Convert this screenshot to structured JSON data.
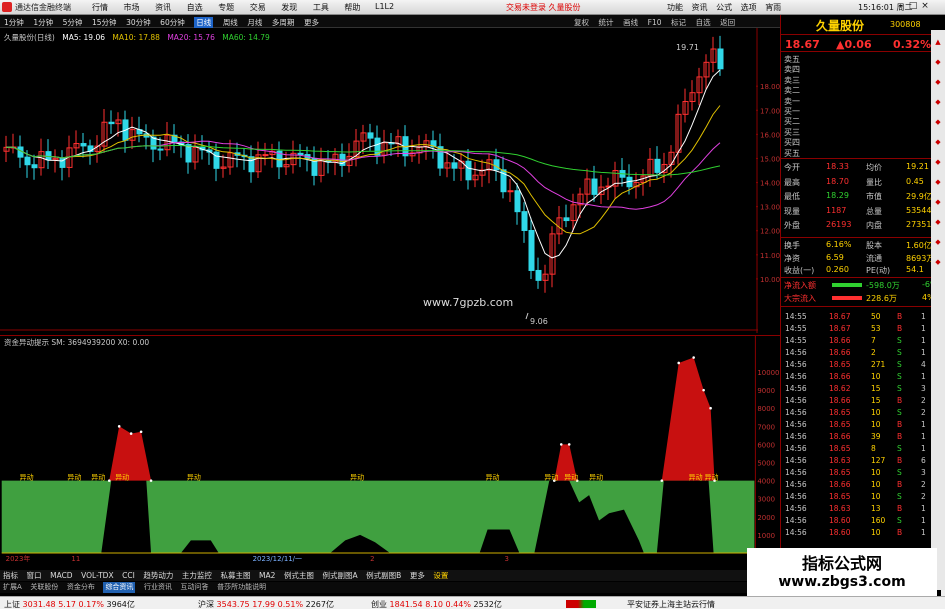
{
  "menubar": {
    "app_title": "通达信金融终端",
    "menu": [
      "行情",
      "市场",
      "资讯",
      "自选",
      "专题",
      "交易",
      "发现",
      "工具",
      "帮助"
    ],
    "version": "L1L2",
    "notice": "交易未登录   久量股份",
    "right": [
      "功能",
      "资讯",
      "公式",
      "选项",
      "宵雨"
    ],
    "clock": "15:16:01",
    "weekday": "周二"
  },
  "toolbar": {
    "periods": [
      "1分钟",
      "1分钟",
      "5分钟",
      "15分钟",
      "30分钟",
      "60分钟",
      "日线",
      "周线",
      "月线",
      "多周期",
      "更多"
    ],
    "active_period": "日线",
    "tools": [
      "复权",
      "统计",
      "画线",
      "F10",
      "标记",
      "自选",
      "返回"
    ]
  },
  "main_legend": {
    "stock": "久量股份(日线)",
    "ma5": "MA5: 19.06",
    "ma10": "MA10: 17.88",
    "ma20": "MA20: 15.76",
    "ma60": "MA60: 14.79"
  },
  "price_axis": [
    "18.00",
    "17.00",
    "16.00",
    "15.00",
    "14.00",
    "13.00",
    "12.00",
    "11.00",
    "10.00"
  ],
  "chart_annotations": {
    "high": "19.71",
    "low": "9.06",
    "website": "www.7gpzb.com"
  },
  "indicator": {
    "legend": "资金异动提示  SM: 3694939200   X0: 0.00",
    "axis": [
      "10000",
      "9000",
      "8000",
      "7000",
      "6000",
      "5000",
      "4000",
      "3000",
      "2000",
      "1000"
    ],
    "marker": "异动",
    "date_labels": [
      "2023年",
      "11",
      "2023/12/11/一",
      "2",
      "3"
    ]
  },
  "tabs": [
    "指标",
    "窗口",
    "MACD",
    "VOL-TDX",
    "CCI",
    "趋势动力",
    "主力监控",
    "私募主图",
    "MA2",
    "例式主图",
    "例式副图A",
    "例式副图B",
    "更多",
    "设置"
  ],
  "tabs_right": "横排",
  "tabs2": [
    "扩展A",
    "关联股份",
    "资金分布",
    "综合资讯",
    "行业资讯",
    "互动问答",
    "普莎所功能说明"
  ],
  "tabs2_active": "综合资讯",
  "status": {
    "sh_label": "上证",
    "sh_value": "3031.48",
    "sh_change": "5.17",
    "sh_pct": "0.17%",
    "sh_amount": "3964亿",
    "sz_label": "沪深",
    "sz_value": "3543.75",
    "sz_change": "17.99",
    "sz_pct": "0.51%",
    "sz_amount": "2267亿",
    "cy_label": "创业",
    "cy_value": "1841.54",
    "cy_change": "8.10",
    "cy_pct": "0.44%",
    "cy_amount": "2532亿",
    "broker": "平安证券上海主站云行情"
  },
  "rpanel": {
    "name": "久量股份",
    "code": "300808",
    "price": "18.67",
    "change": "▲0.06",
    "pct": "0.32%",
    "orderbook": [
      "卖五",
      "卖四",
      "卖三",
      "卖二",
      "卖一",
      "买一",
      "买二",
      "买三",
      "买四",
      "买五"
    ],
    "stats": [
      [
        "今开",
        "18.33",
        "均价",
        "19.21"
      ],
      [
        "最高",
        "18.70",
        "量比",
        "0.45"
      ],
      [
        "最低",
        "18.29",
        "市值",
        "29.9亿"
      ],
      [
        "现量",
        "1187",
        "总量",
        "53544"
      ],
      [
        "外盘",
        "26193",
        "内盘",
        "27351"
      ]
    ],
    "stats2": [
      [
        "换手",
        "6.16%",
        "股本",
        "1.60亿"
      ],
      [
        "净资",
        "6.59",
        "流通",
        "8693万"
      ],
      [
        "收益(一)",
        "0.260",
        "PE(动)",
        "54.1"
      ]
    ],
    "flow": [
      [
        "净流入额",
        "-598.0万",
        "-6%"
      ],
      [
        "大宗流入",
        "228.6万",
        "4%"
      ]
    ],
    "trades": [
      [
        "14:55",
        "18.67",
        "50",
        "B",
        "1"
      ],
      [
        "14:55",
        "18.67",
        "53",
        "B",
        "1"
      ],
      [
        "14:55",
        "18.66",
        "7",
        "S",
        "1"
      ],
      [
        "14:56",
        "18.66",
        "2",
        "S",
        "1"
      ],
      [
        "14:56",
        "18.65",
        "271",
        "S",
        "4"
      ],
      [
        "14:56",
        "18.66",
        "10",
        "S",
        "1"
      ],
      [
        "14:56",
        "18.62",
        "15",
        "S",
        "3"
      ],
      [
        "14:56",
        "18.66",
        "15",
        "B",
        "2"
      ],
      [
        "14:56",
        "18.65",
        "10",
        "S",
        "2"
      ],
      [
        "14:56",
        "18.65",
        "10",
        "B",
        "1"
      ],
      [
        "14:56",
        "18.66",
        "39",
        "B",
        "1"
      ],
      [
        "14:56",
        "18.65",
        "8",
        "S",
        "1"
      ],
      [
        "14:56",
        "18.63",
        "127",
        "B",
        "6"
      ],
      [
        "14:56",
        "18.65",
        "10",
        "S",
        "3"
      ],
      [
        "14:56",
        "18.66",
        "10",
        "B",
        "2"
      ],
      [
        "14:56",
        "18.65",
        "10",
        "S",
        "2"
      ],
      [
        "14:56",
        "18.63",
        "13",
        "B",
        "1"
      ],
      [
        "14:56",
        "18.60",
        "160",
        "S",
        "1"
      ],
      [
        "14:56",
        "18.60",
        "10",
        "B",
        "1"
      ]
    ]
  },
  "watermark": {
    "line1": "指标公式网",
    "line2": "www.zbgs3.com"
  },
  "chart_data": [
    {
      "type": "candlestick",
      "title": "久量股份(日线)",
      "ylim": [
        9.0,
        20.0
      ],
      "series": [
        {
          "name": "MA5",
          "color": "#ffffff"
        },
        {
          "name": "MA10",
          "color": "#e0c000"
        },
        {
          "name": "MA20",
          "color": "#e040e0"
        },
        {
          "name": "MA60",
          "color": "#30d030"
        }
      ],
      "high": 19.71,
      "low": 9.06
    },
    {
      "type": "area",
      "title": "资金异动提示",
      "ylim": [
        0,
        10000
      ],
      "red_peaks": [
        7000,
        6000,
        10500
      ],
      "threshold": 4000
    }
  ]
}
